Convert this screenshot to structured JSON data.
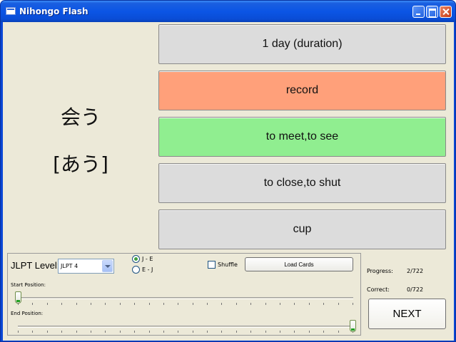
{
  "window": {
    "title": "Nihongo Flash"
  },
  "card": {
    "kanji": "会う",
    "reading": "[あう]"
  },
  "answers": [
    {
      "label": "1 day (duration)",
      "state": "neutral",
      "color": "#dcdcdc"
    },
    {
      "label": "record",
      "state": "wrong",
      "color": "#ffa07a"
    },
    {
      "label": "to meet,to see",
      "state": "correct",
      "color": "#90ee90"
    },
    {
      "label": "to close,to shut",
      "state": "neutral",
      "color": "#dcdcdc"
    },
    {
      "label": "cup",
      "state": "neutral",
      "color": "#dcdcdc"
    }
  ],
  "controls": {
    "jlpt_label": "JLPT Level:",
    "jlpt_selected": "JLPT 4",
    "radio_je": "J - E",
    "radio_ej": "E - J",
    "radio_selected": "J - E",
    "shuffle_label": "Shuffle",
    "shuffle_checked": false,
    "load_button": "Load Cards",
    "start_label": "Start Position:",
    "end_label": "End Position:",
    "start_position_fraction": 0.0,
    "end_position_fraction": 1.0
  },
  "stats": {
    "progress_label": "Progress:",
    "progress_value": "2/722",
    "correct_label": "Correct:",
    "correct_value": "0/722",
    "next_button": "NEXT"
  }
}
